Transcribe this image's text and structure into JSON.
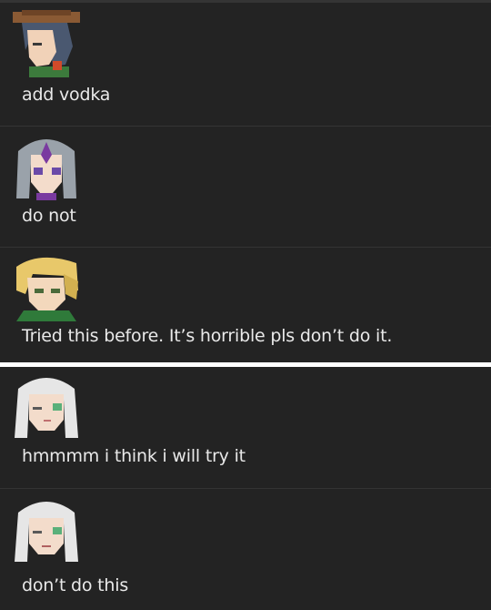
{
  "thread": {
    "messages": [
      {
        "avatar_icon": "cowboy-hat-character-avatar",
        "text": "add vodka"
      },
      {
        "avatar_icon": "silver-haired-girl-avatar",
        "text": "do not"
      },
      {
        "avatar_icon": "blonde-boy-avatar",
        "text": "Tried this before. It’s horrible pls don’t do it."
      },
      {
        "avatar_icon": "white-haired-girl-avatar",
        "text": "hmmmm i think i will try it"
      },
      {
        "avatar_icon": "white-haired-girl-worried-avatar",
        "text": "don’t do this"
      }
    ]
  },
  "colors": {
    "background": "#232323",
    "divider": "#343434",
    "text": "#e9e9e9",
    "separator": "#ffffff"
  }
}
